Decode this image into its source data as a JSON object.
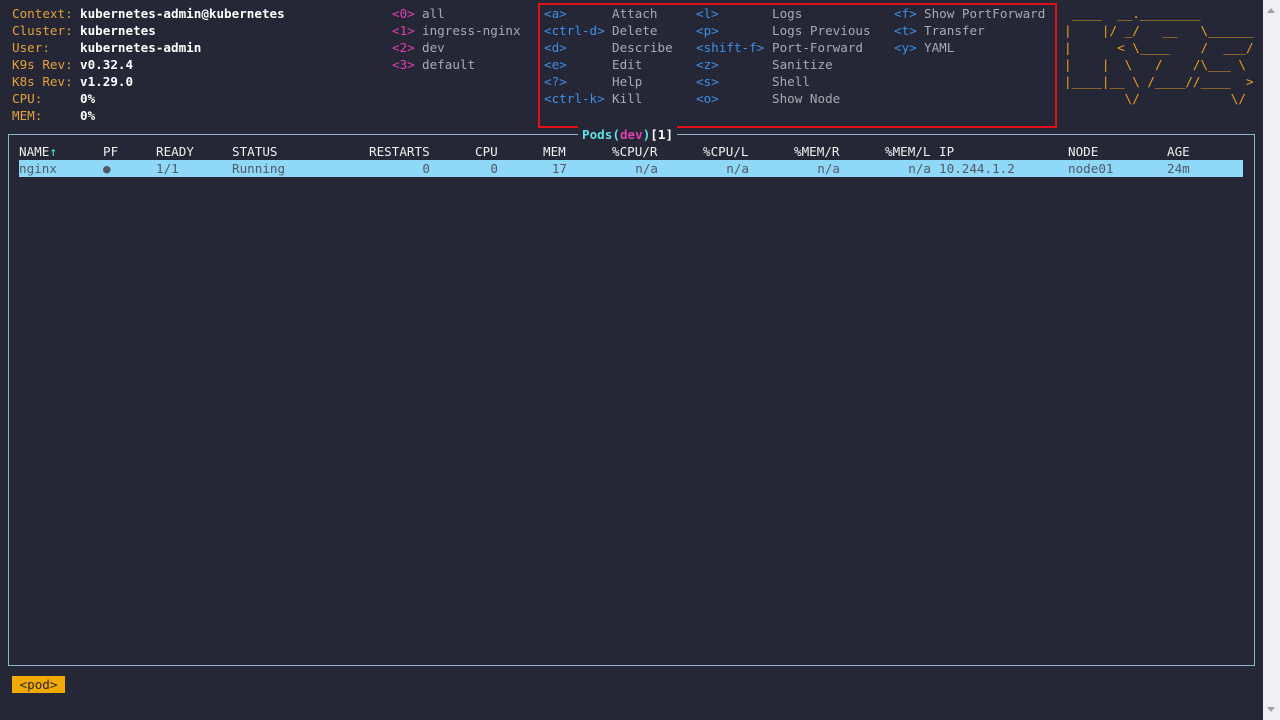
{
  "info": [
    {
      "label": "Context:",
      "value": "kubernetes-admin@kubernetes"
    },
    {
      "label": "Cluster:",
      "value": "kubernetes"
    },
    {
      "label": "User:",
      "value": "kubernetes-admin"
    },
    {
      "label": "K9s Rev:",
      "value": "v0.32.4"
    },
    {
      "label": "K8s Rev:",
      "value": "v1.29.0"
    },
    {
      "label": "CPU:",
      "value": "0%"
    },
    {
      "label": "MEM:",
      "value": "0%"
    }
  ],
  "namespaces": [
    {
      "key": "<0>",
      "name": "all"
    },
    {
      "key": "<1>",
      "name": "ingress-nginx"
    },
    {
      "key": "<2>",
      "name": "dev"
    },
    {
      "key": "<3>",
      "name": "default"
    }
  ],
  "hotkeys": {
    "col1": [
      {
        "key": "<a>",
        "desc": "Attach"
      },
      {
        "key": "<ctrl-d>",
        "desc": "Delete"
      },
      {
        "key": "<d>",
        "desc": "Describe"
      },
      {
        "key": "<e>",
        "desc": "Edit"
      },
      {
        "key": "<?>",
        "desc": "Help"
      },
      {
        "key": "<ctrl-k>",
        "desc": "Kill"
      }
    ],
    "col2": [
      {
        "key": "<l>",
        "desc": "Logs"
      },
      {
        "key": "<p>",
        "desc": "Logs Previous"
      },
      {
        "key": "<shift-f>",
        "desc": "Port-Forward"
      },
      {
        "key": "<z>",
        "desc": "Sanitize"
      },
      {
        "key": "<s>",
        "desc": "Shell"
      },
      {
        "key": "<o>",
        "desc": "Show Node"
      }
    ],
    "col3": [
      {
        "key": "<f>",
        "desc": "Show PortForward"
      },
      {
        "key": "<t>",
        "desc": "Transfer"
      },
      {
        "key": "<y>",
        "desc": "YAML"
      }
    ]
  },
  "logo": " ____  __.________       \n|    |/ _/   __   \\______\n|      < \\____    /  ___/\n|    |  \\   /    /\\___ \\ \n|____|__ \\ /____//____  >\n        \\/            \\/ ",
  "panel": {
    "resource": "Pods",
    "open": "(",
    "namespace": "dev",
    "close": ")",
    "count": "[1]"
  },
  "table": {
    "headers": {
      "name": "NAME",
      "sort": "↑",
      "pf": "PF",
      "ready": "READY",
      "status": "STATUS",
      "restarts": "RESTARTS",
      "cpu": "CPU",
      "mem": "MEM",
      "cpur": "%CPU/R",
      "cpul": "%CPU/L",
      "memr": "%MEM/R",
      "meml": "%MEM/L",
      "ip": "IP",
      "node": "NODE",
      "age": "AGE"
    },
    "rows": [
      {
        "name": "nginx",
        "pf": "●",
        "ready": "1/1",
        "status": "Running",
        "restarts": "0",
        "cpu": "0",
        "mem": "17",
        "cpur": "n/a",
        "cpul": "n/a",
        "memr": "n/a",
        "meml": "n/a",
        "ip": "10.244.1.2",
        "node": "node01",
        "age": "24m"
      }
    ]
  },
  "crumb": "<pod>"
}
